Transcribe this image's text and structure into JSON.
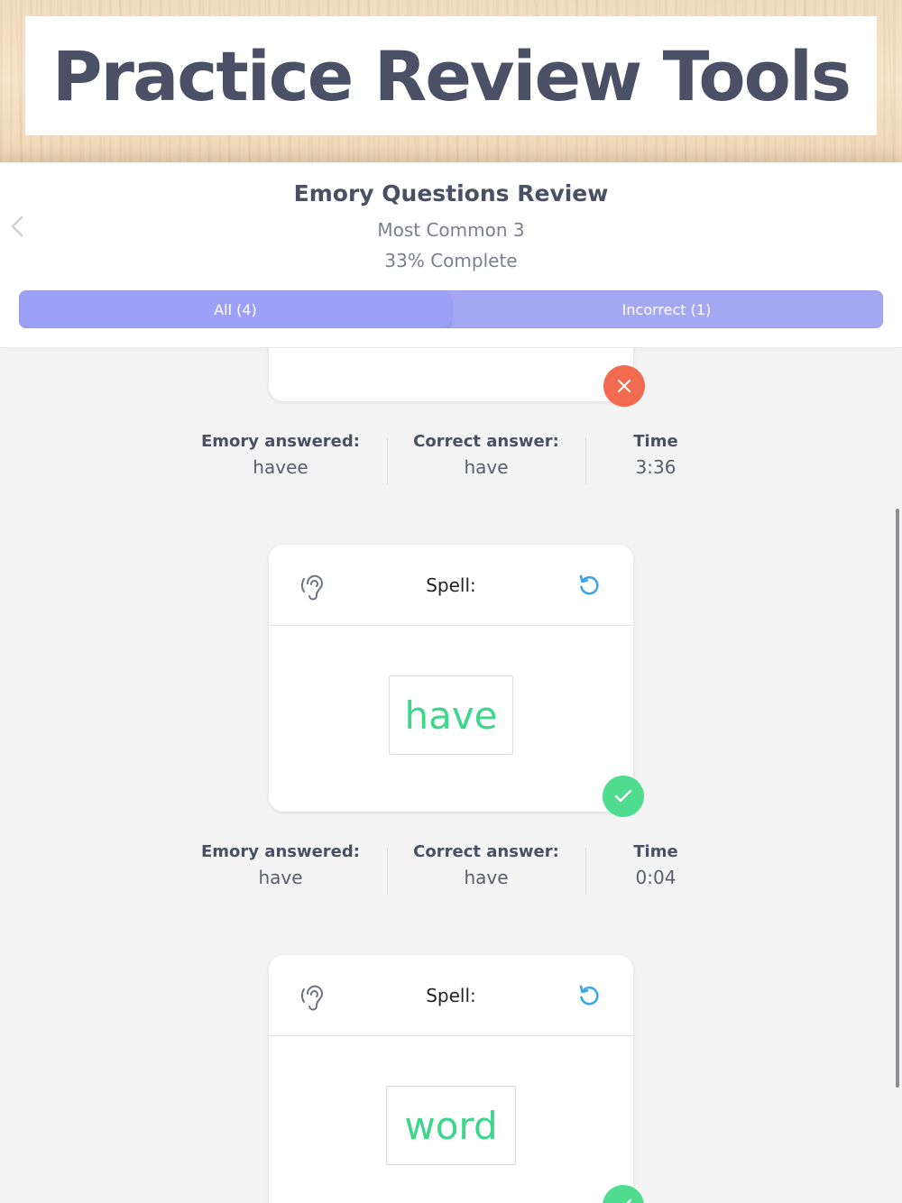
{
  "banner": {
    "title": "Practice Review Tools"
  },
  "header": {
    "title": "Emory Questions Review",
    "subtitle": "Most Common 3",
    "progress": "33% Complete",
    "back_icon": "chevron-left-icon"
  },
  "tabs": [
    {
      "label": "All (4)",
      "active": true
    },
    {
      "label": "Incorrect (1)",
      "active": false
    }
  ],
  "colors": {
    "accent": "#9ca1f7",
    "correct": "#4fdc8f",
    "incorrect": "#f26a4f",
    "word": "#3ed68b",
    "replay": "#3aa6e8"
  },
  "questions": [
    {
      "status": "incorrect",
      "stats": {
        "answered_label": "Emory answered:",
        "answered": "havee",
        "correct_label": "Correct answer:",
        "correct": "have",
        "time_label": "Time",
        "time": "3:36"
      }
    },
    {
      "status": "correct",
      "prompt": "Spell:",
      "word": "have",
      "stats": {
        "answered_label": "Emory answered:",
        "answered": "have",
        "correct_label": "Correct answer:",
        "correct": "have",
        "time_label": "Time",
        "time": "0:04"
      }
    },
    {
      "status": "correct",
      "prompt": "Spell:",
      "word": "word"
    }
  ]
}
